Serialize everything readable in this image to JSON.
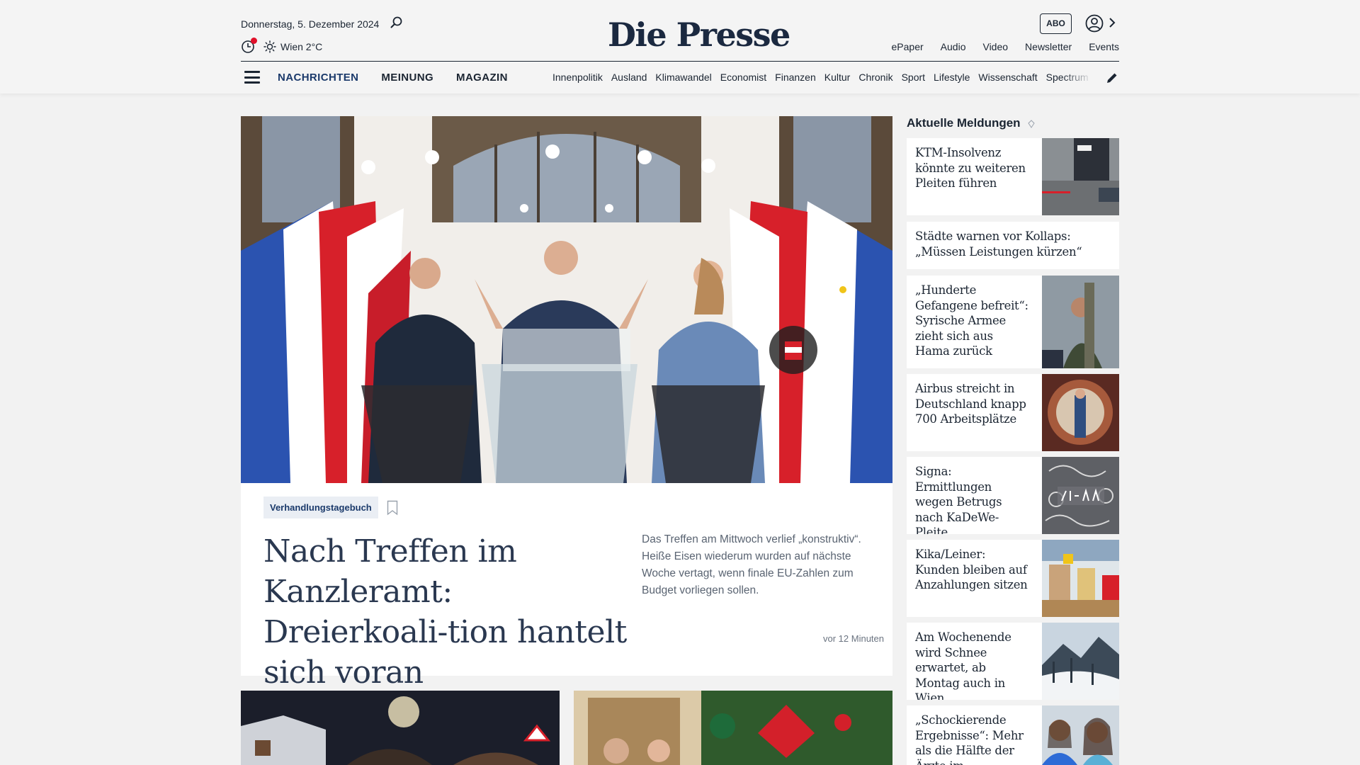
{
  "header": {
    "date": "Donnerstag, 5. Dezember 2024",
    "weather": "Wien 2°C",
    "logo": "Die Presse",
    "abo_label": "ABO",
    "top_links": [
      "ePaper",
      "Audio",
      "Video",
      "Newsletter",
      "Events"
    ],
    "main_nav": [
      "NACHRICHTEN",
      "MEINUNG",
      "MAGAZIN"
    ],
    "sub_nav": [
      "Innenpolitik",
      "Ausland",
      "Klimawandel",
      "Economist",
      "Finanzen",
      "Kultur",
      "Chronik",
      "Sport",
      "Lifestyle",
      "Wissenschaft",
      "Spectrum"
    ],
    "icons": [
      "search-icon",
      "clock-icon",
      "sun-icon",
      "user-icon",
      "chevron-right-icon",
      "menu-icon",
      "pencil-icon"
    ]
  },
  "hero": {
    "tag": "Verhandlungstagebuch",
    "title": "Nach Treffen im Kanzleramt: Dreierkoali-tion hantelt sich voran",
    "teaser": "Das Treffen am Mittwoch verlief „konstruktiv“. Heiße Eisen wiederum wurden auf nächste Woche vertagt, wenn finale EU-Zahlen zum Budget vorliegen sollen.",
    "time": "vor 12 Minuten"
  },
  "sidebar": {
    "heading": "Aktuelle Meldungen",
    "items": [
      {
        "title": "KTM-Insolvenz könnte zu weiteren Pleiten führen"
      },
      {
        "title": "Städte warnen vor Kollaps: „Müssen Leistungen kürzen“"
      },
      {
        "title": "„Hunderte Gefangene befreit“: Syrische Armee zieht sich aus Hama zurück"
      },
      {
        "title": "Airbus streicht in Deutschland knapp 700 Arbeitsplätze"
      },
      {
        "title": "Signa: Ermittlungen wegen Betrugs nach KaDeWe-Pleite"
      },
      {
        "title": "Kika/Leiner: Kunden bleiben auf Anzahlungen sitzen"
      },
      {
        "title": "Am Wochenende wird Schnee erwartet, ab Montag auch in Wien"
      },
      {
        "title": "„Schockierende Ergebnisse“: Mehr als die Hälfte der Ärzte im Gesundheitswesen"
      }
    ]
  }
}
